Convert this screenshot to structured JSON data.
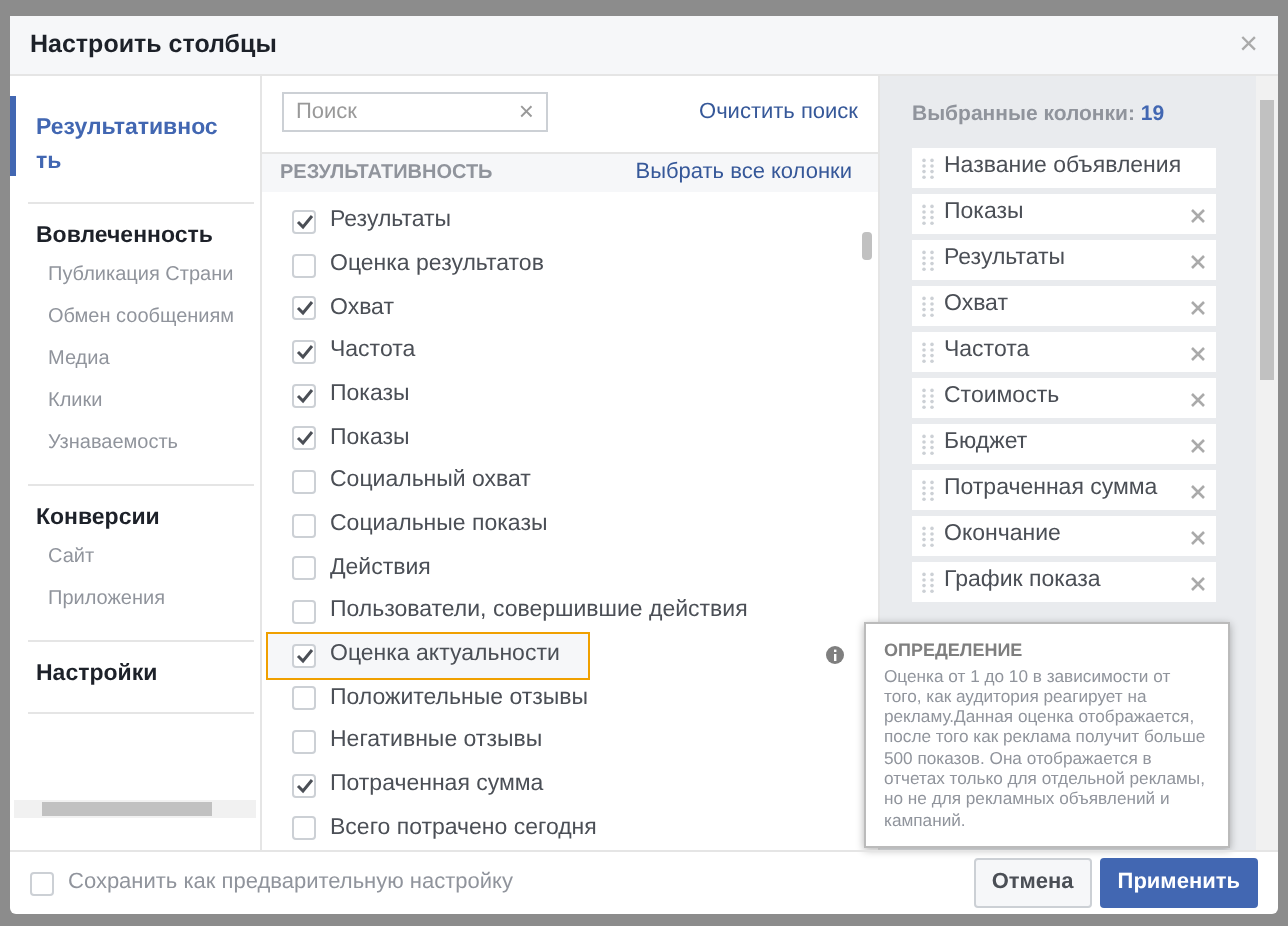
{
  "dialog": {
    "title": "Настроить столбцы",
    "close": "×"
  },
  "nav": [
    {
      "label": "Результативность",
      "selected": true
    },
    {
      "label": "Вовлеченность",
      "selected": false,
      "children": [
        {
          "label": "Публикация Страни",
          "selected": false
        },
        {
          "label": "Обмен сообщениям",
          "selected": false
        },
        {
          "label": "Медиа",
          "selected": false
        },
        {
          "label": "Клики",
          "selected": false
        },
        {
          "label": "Узнаваемость",
          "selected": false
        }
      ]
    },
    {
      "label": "Конверсии",
      "selected": false,
      "children": [
        {
          "label": "Сайт",
          "selected": false
        },
        {
          "label": "Приложения",
          "selected": false
        }
      ]
    },
    {
      "label": "Настройки",
      "selected": false
    }
  ],
  "search": {
    "placeholder": "Поиск",
    "clear": "×",
    "clear_search": "Очистить поиск"
  },
  "section": {
    "title": "РЕЗУЛЬТАТИВНОСТЬ",
    "select_all": "Выбрать все колонки"
  },
  "metrics": [
    {
      "label": "Результаты",
      "checked": true,
      "highlighted": false
    },
    {
      "label": "Оценка результатов",
      "checked": false,
      "highlighted": false
    },
    {
      "label": "Охват",
      "checked": true,
      "highlighted": false
    },
    {
      "label": "Частота",
      "checked": true,
      "highlighted": false
    },
    {
      "label": "Показы",
      "checked": true,
      "highlighted": false
    },
    {
      "label": "Показы",
      "checked": true,
      "highlighted": false
    },
    {
      "label": "Социальный охват",
      "checked": false,
      "highlighted": false
    },
    {
      "label": "Социальные показы",
      "checked": false,
      "highlighted": false
    },
    {
      "label": "Действия",
      "checked": false,
      "highlighted": false
    },
    {
      "label": "Пользователи, совершившие действия",
      "checked": false,
      "highlighted": false
    },
    {
      "label": "Оценка актуальности",
      "checked": true,
      "highlighted": true
    },
    {
      "label": "Положительные отзывы",
      "checked": false,
      "highlighted": false
    },
    {
      "label": "Негативные отзывы",
      "checked": false,
      "highlighted": false
    },
    {
      "label": "Потраченная сумма",
      "checked": true,
      "highlighted": false
    },
    {
      "label": "Всего потрачено сегодня",
      "checked": false,
      "highlighted": false
    }
  ],
  "selected_columns": {
    "label": "Выбранные колонки:",
    "count": "19",
    "items": [
      {
        "label": "Название объявления",
        "removable": false
      },
      {
        "label": "Показы",
        "removable": true
      },
      {
        "label": "Результаты",
        "removable": true
      },
      {
        "label": "Охват",
        "removable": true
      },
      {
        "label": "Частота",
        "removable": true
      },
      {
        "label": "Стоимость",
        "removable": true
      },
      {
        "label": "Бюджет",
        "removable": true
      },
      {
        "label": "Потраченная сумма",
        "removable": true
      },
      {
        "label": "Окончание",
        "removable": true
      },
      {
        "label": "График показа",
        "removable": true
      }
    ]
  },
  "tooltip": {
    "title": "ОПРЕДЕЛЕНИЕ",
    "text": "Оценка от 1 до 10 в зависимости от того, как аудитория реагирует на рекламу.Данная оценка отображается, после того как реклама получит больше 500 показов. Она отображается в отчетах только для отдельной рекламы, но не для рекламных объявлений и кампаний."
  },
  "footer": {
    "save_preset": {
      "label": "Сохранить как предварительную настройку",
      "checked": false
    },
    "buttons": [
      {
        "label": "Отмена",
        "kind": "secondary"
      },
      {
        "label": "Применить",
        "kind": "primary"
      }
    ]
  }
}
